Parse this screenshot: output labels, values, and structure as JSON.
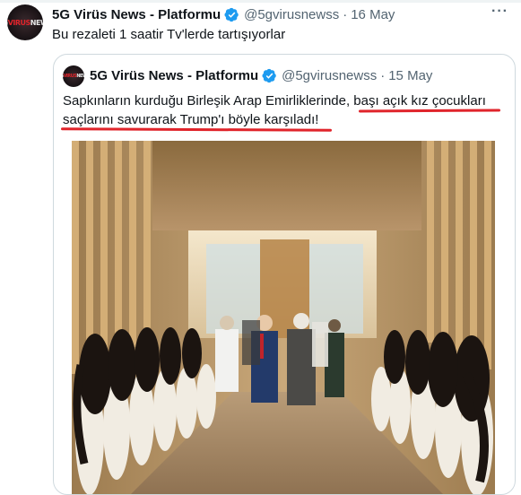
{
  "tweet": {
    "author_name": "5G Virüs News - Platformu",
    "handle": "@5gvirusnewss",
    "separator": "·",
    "date": "16 May",
    "text": "Bu rezaleti 1 saatir Tv'lerde tartışıyorlar",
    "more_menu": "···"
  },
  "quoted_tweet": {
    "author_name": "5G Virüs News - Platformu",
    "handle": "@5gvirusnewss",
    "separator": "·",
    "date": "15 May",
    "text_line1": "Sapkınların kurduğu Birleşik Arap Emirliklerinde, başı açık kız çocukları",
    "text_line2": "saçlarını savurarak Trump'ı böyle karşıladı!",
    "media": {
      "type": "video",
      "description_icon": "video-thumbnail"
    }
  },
  "avatar_logo": {
    "part1": "5G",
    "part2": "VIRUS",
    "part3": "NEWS"
  },
  "colors": {
    "verified_blue": "#1d9bf0",
    "annotation_red": "#e0242b",
    "secondary_text": "#536471",
    "border": "#cfd9de"
  }
}
